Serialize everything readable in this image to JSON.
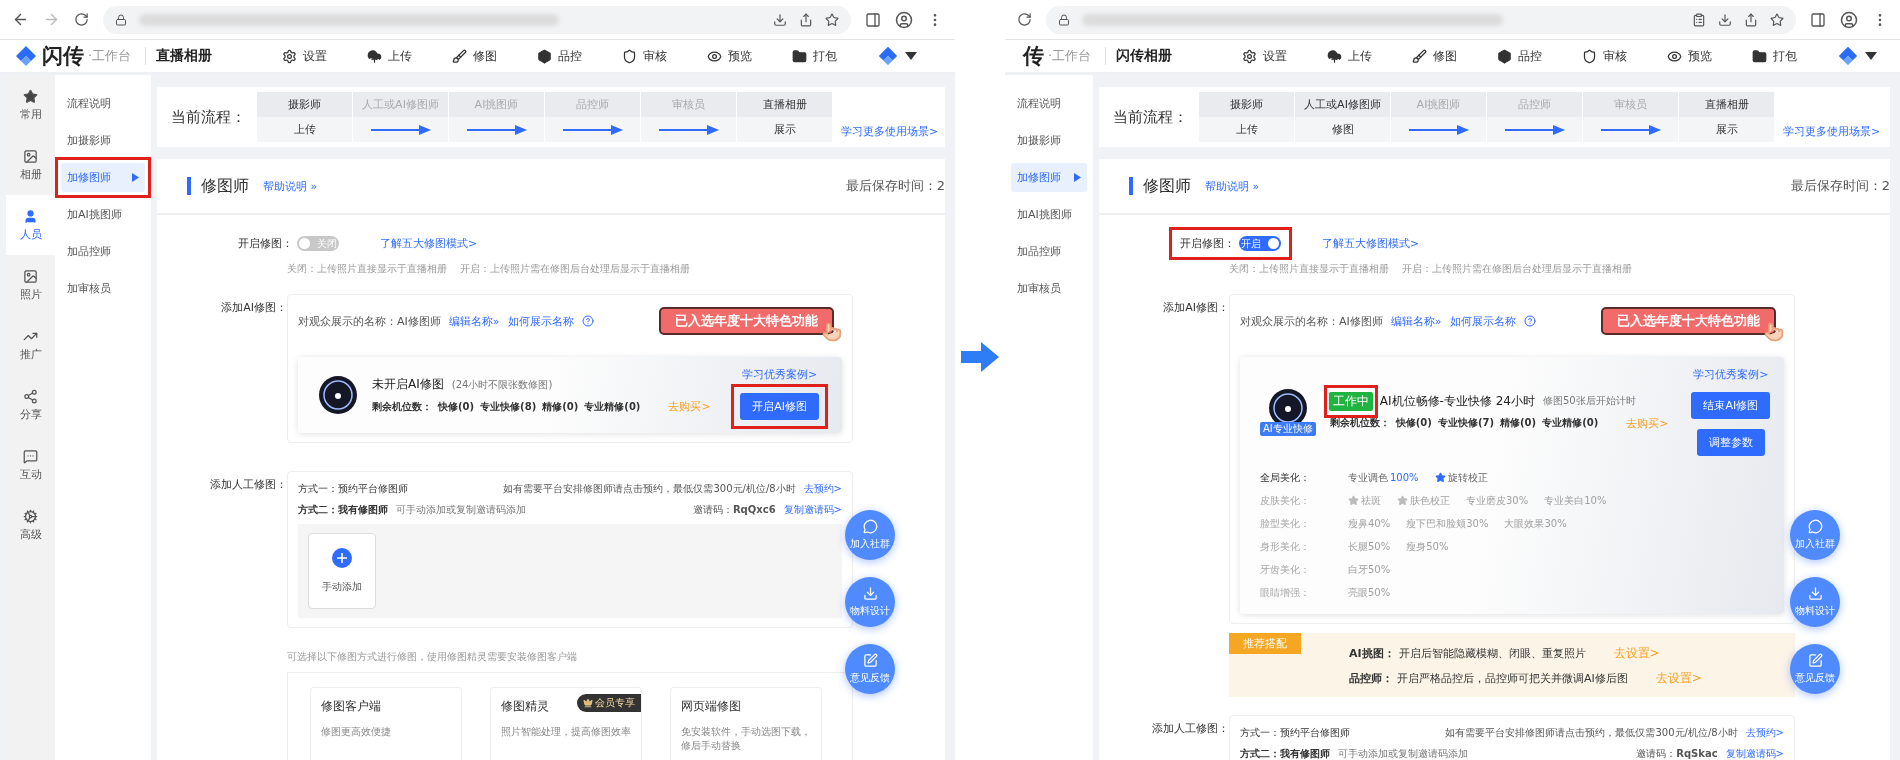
{
  "panels": [
    {
      "kind": "full",
      "brand": {
        "name": "闪传",
        "suffix": "·工作台"
      },
      "album_title": "直播相册",
      "nav": [
        "设置",
        "上传",
        "修图",
        "品控",
        "审核",
        "预览",
        "打包"
      ],
      "rail": [
        {
          "label": "常用",
          "selected": false
        },
        {
          "label": "相册",
          "selected": false
        },
        {
          "label": "人员",
          "selected": true
        },
        {
          "label": "照片",
          "selected": false
        },
        {
          "label": "推广",
          "selected": false
        },
        {
          "label": "分享",
          "selected": false
        },
        {
          "label": "互动",
          "selected": false
        },
        {
          "label": "高级",
          "selected": false
        }
      ],
      "submenu": [
        {
          "label": "流程说明",
          "selected": false,
          "highlighted": false
        },
        {
          "label": "加摄影师",
          "selected": false,
          "highlighted": false
        },
        {
          "label": "加修图师",
          "selected": true,
          "highlighted": true
        },
        {
          "label": "加AI挑图师",
          "selected": false,
          "highlighted": false
        },
        {
          "label": "加品控师",
          "selected": false,
          "highlighted": false
        },
        {
          "label": "加审核员",
          "selected": false,
          "highlighted": false
        }
      ],
      "flow": {
        "label": "当前流程：",
        "link": "学习更多使用场景>",
        "steps": [
          {
            "role": "摄影师",
            "action": "上传",
            "active": true
          },
          {
            "role": "人工或AI修图师",
            "active": false
          },
          {
            "role": "AI挑图师",
            "active": false
          },
          {
            "role": "品控师",
            "active": false
          },
          {
            "role": "审核员",
            "active": false
          },
          {
            "role": "直播相册",
            "action": "展示",
            "active": true
          }
        ]
      },
      "section": {
        "title": "修图师",
        "help": "帮助说明 »",
        "saved": "最后保存时间：2"
      },
      "toggle_row": {
        "label": "开启修图：",
        "switch": {
          "on": false,
          "text": "关闭"
        },
        "highlighted": false,
        "link": "了解五大修图模式>",
        "note": "关闭：上传照片直接显示于直播相册    开启：上传照片需在修图后台处理后显示于直播相册"
      },
      "ai": {
        "label": "添加AI修图：",
        "display_name": "对观众展示的名称：AI修图师",
        "edit_link": "编辑名称»",
        "how_link": "如何展示名称",
        "award": "已入选年度十大特色功能",
        "card": {
          "title": "未开启AI修图",
          "subtitle": "(24小时不限张数修图)",
          "quota_label": "剩余机位数：",
          "quotas": [
            "快修(0)",
            "专业快修(8)",
            "精修(0)",
            "专业精修(0)"
          ],
          "buy": "去购买>",
          "case_link": "学习优秀案例>",
          "buttons": [
            {
              "label": "开启AI修图",
              "highlighted": true
            }
          ]
        }
      },
      "manual": {
        "label": "添加人工修图：",
        "ways": [
          {
            "title": "方式一：预约平台修图师",
            "note": "如有需要平台安排修图师请点击预约，最低仅需300元/机位/8小时",
            "link": "去预约>"
          },
          {
            "title": "方式二：我有修图师",
            "desc": "可手动添加或复制邀请码添加",
            "note": "邀请码：**RqQxc6**",
            "link": "复制邀请码>"
          }
        ],
        "add_tile": "手动添加"
      },
      "tools": {
        "hint": "可选择以下修图方式进行修图，使用修图精灵需要安装修图客户端",
        "cards": [
          {
            "title": "修图客户端",
            "desc": "修图更高效便捷"
          },
          {
            "title": "修图精灵",
            "desc": "照片智能处理，提高修图效率",
            "badge": "会员专享"
          },
          {
            "title": "网页端修图",
            "desc": "免安装软件，手动选图下载，修后手动替换"
          }
        ]
      },
      "float_buttons": [
        "加入社群",
        "物料设计",
        "意见反馈"
      ]
    },
    {
      "kind": "cropped",
      "brand": {
        "name": "传",
        "suffix": "·工作台"
      },
      "album_title": "闪传相册",
      "nav": [
        "设置",
        "上传",
        "修图",
        "品控",
        "审核",
        "预览",
        "打包"
      ],
      "submenu": [
        {
          "label": "流程说明",
          "selected": false,
          "highlighted": false
        },
        {
          "label": "加摄影师",
          "selected": false,
          "highlighted": false
        },
        {
          "label": "加修图师",
          "selected": true,
          "highlighted": false
        },
        {
          "label": "加AI挑图师",
          "selected": false,
          "highlighted": false
        },
        {
          "label": "加品控师",
          "selected": false,
          "highlighted": false
        },
        {
          "label": "加审核员",
          "selected": false,
          "highlighted": false
        }
      ],
      "flow": {
        "label": "当前流程：",
        "link": "学习更多使用场景>",
        "steps": [
          {
            "role": "摄影师",
            "action": "上传",
            "active": true
          },
          {
            "role": "人工或AI修图师",
            "action": "修图",
            "active": true
          },
          {
            "role": "AI挑图师",
            "active": false
          },
          {
            "role": "品控师",
            "active": false
          },
          {
            "role": "审核员",
            "active": false
          },
          {
            "role": "直播相册",
            "action": "展示",
            "active": true
          }
        ]
      },
      "section": {
        "title": "修图师",
        "help": "帮助说明 »",
        "saved": "最后保存时间：2"
      },
      "toggle_row": {
        "label": "开启修图：",
        "switch": {
          "on": true,
          "text": "开启"
        },
        "highlighted": true,
        "link": "了解五大修图模式>",
        "note": "关闭：上传照片直接显示于直播相册    开启：上传照片需在修图后台处理后显示于直播相册"
      },
      "ai": {
        "label": "添加AI修图：",
        "display_name": "对观众展示的名称：AI修图师",
        "edit_link": "编辑名称»",
        "how_link": "如何展示名称",
        "award": "已入选年度十大特色功能",
        "card": {
          "tag": {
            "text": "工作中",
            "highlighted": true
          },
          "avatar_badge": "AI专业快修",
          "title": "AI机位畅修-专业快修 24小时",
          "subtitle": "修图50张后开始计时",
          "quota_label": "剩余机位数：",
          "quotas": [
            "快修(0)",
            "专业快修(7)",
            "精修(0)",
            "专业精修(0)"
          ],
          "buy": "去购买>",
          "case_link": "学习优秀案例>",
          "buttons": [
            {
              "label": "结束AI修图",
              "highlighted": false
            },
            {
              "label": "调整参数",
              "highlighted": false
            }
          ],
          "settings": [
            {
              "label": "全局美化：",
              "disabled": false,
              "items": [
                {
                  "text": "专业调色",
                  "value": "100%",
                  "starred": false
                },
                {
                  "text": "旋转校正",
                  "starred": true
                }
              ]
            },
            {
              "label": "皮肤美化：",
              "disabled": true,
              "items": [
                {
                  "text": "祛斑",
                  "starred": true
                },
                {
                  "text": "肤色校正",
                  "starred": true
                },
                {
                  "text": "专业磨皮30%",
                  "starred": false
                },
                {
                  "text": "专业美白10%",
                  "starred": false
                }
              ]
            },
            {
              "label": "脸型美化：",
              "disabled": true,
              "items": [
                {
                  "text": "瘦鼻40%",
                  "starred": false
                },
                {
                  "text": "瘦下巴和脸颊30%",
                  "starred": false
                },
                {
                  "text": "大眼效果30%",
                  "starred": false
                }
              ]
            },
            {
              "label": "身形美化：",
              "disabled": true,
              "items": [
                {
                  "text": "长腿50%",
                  "starred": false
                },
                {
                  "text": "瘦身50%",
                  "starred": false
                }
              ]
            },
            {
              "label": "牙齿美化：",
              "disabled": true,
              "items": [
                {
                  "text": "白牙50%",
                  "starred": false
                }
              ]
            },
            {
              "label": "眼睛增强：",
              "disabled": true,
              "items": [
                {
                  "text": "亮眼50%",
                  "starred": false
                }
              ]
            }
          ]
        }
      },
      "recommend": {
        "tag": "推荐搭配",
        "rows": [
          {
            "label": "AI挑图：",
            "text": "开启后智能隐藏模糊、闭眼、重复照片",
            "link": "去设置>"
          },
          {
            "label": "品控师：",
            "text": "开启严格品控后，品控师可把关并微调AI修后图",
            "link": "去设置>"
          }
        ]
      },
      "manual": {
        "label": "添加人工修图：",
        "ways": [
          {
            "title": "方式一：预约平台修图师",
            "note": "如有需要平台安排修图师请点击预约，最低仅需300元/机位/8小时",
            "link": "去预约>"
          },
          {
            "title": "方式二：我有修图师",
            "desc": "可手动添加或复制邀请码添加",
            "note": "邀请码：**RqSkac**",
            "link": "复制邀请码>"
          }
        ]
      },
      "float_buttons": [
        "加入社群",
        "物料设计",
        "意见反馈"
      ]
    }
  ]
}
